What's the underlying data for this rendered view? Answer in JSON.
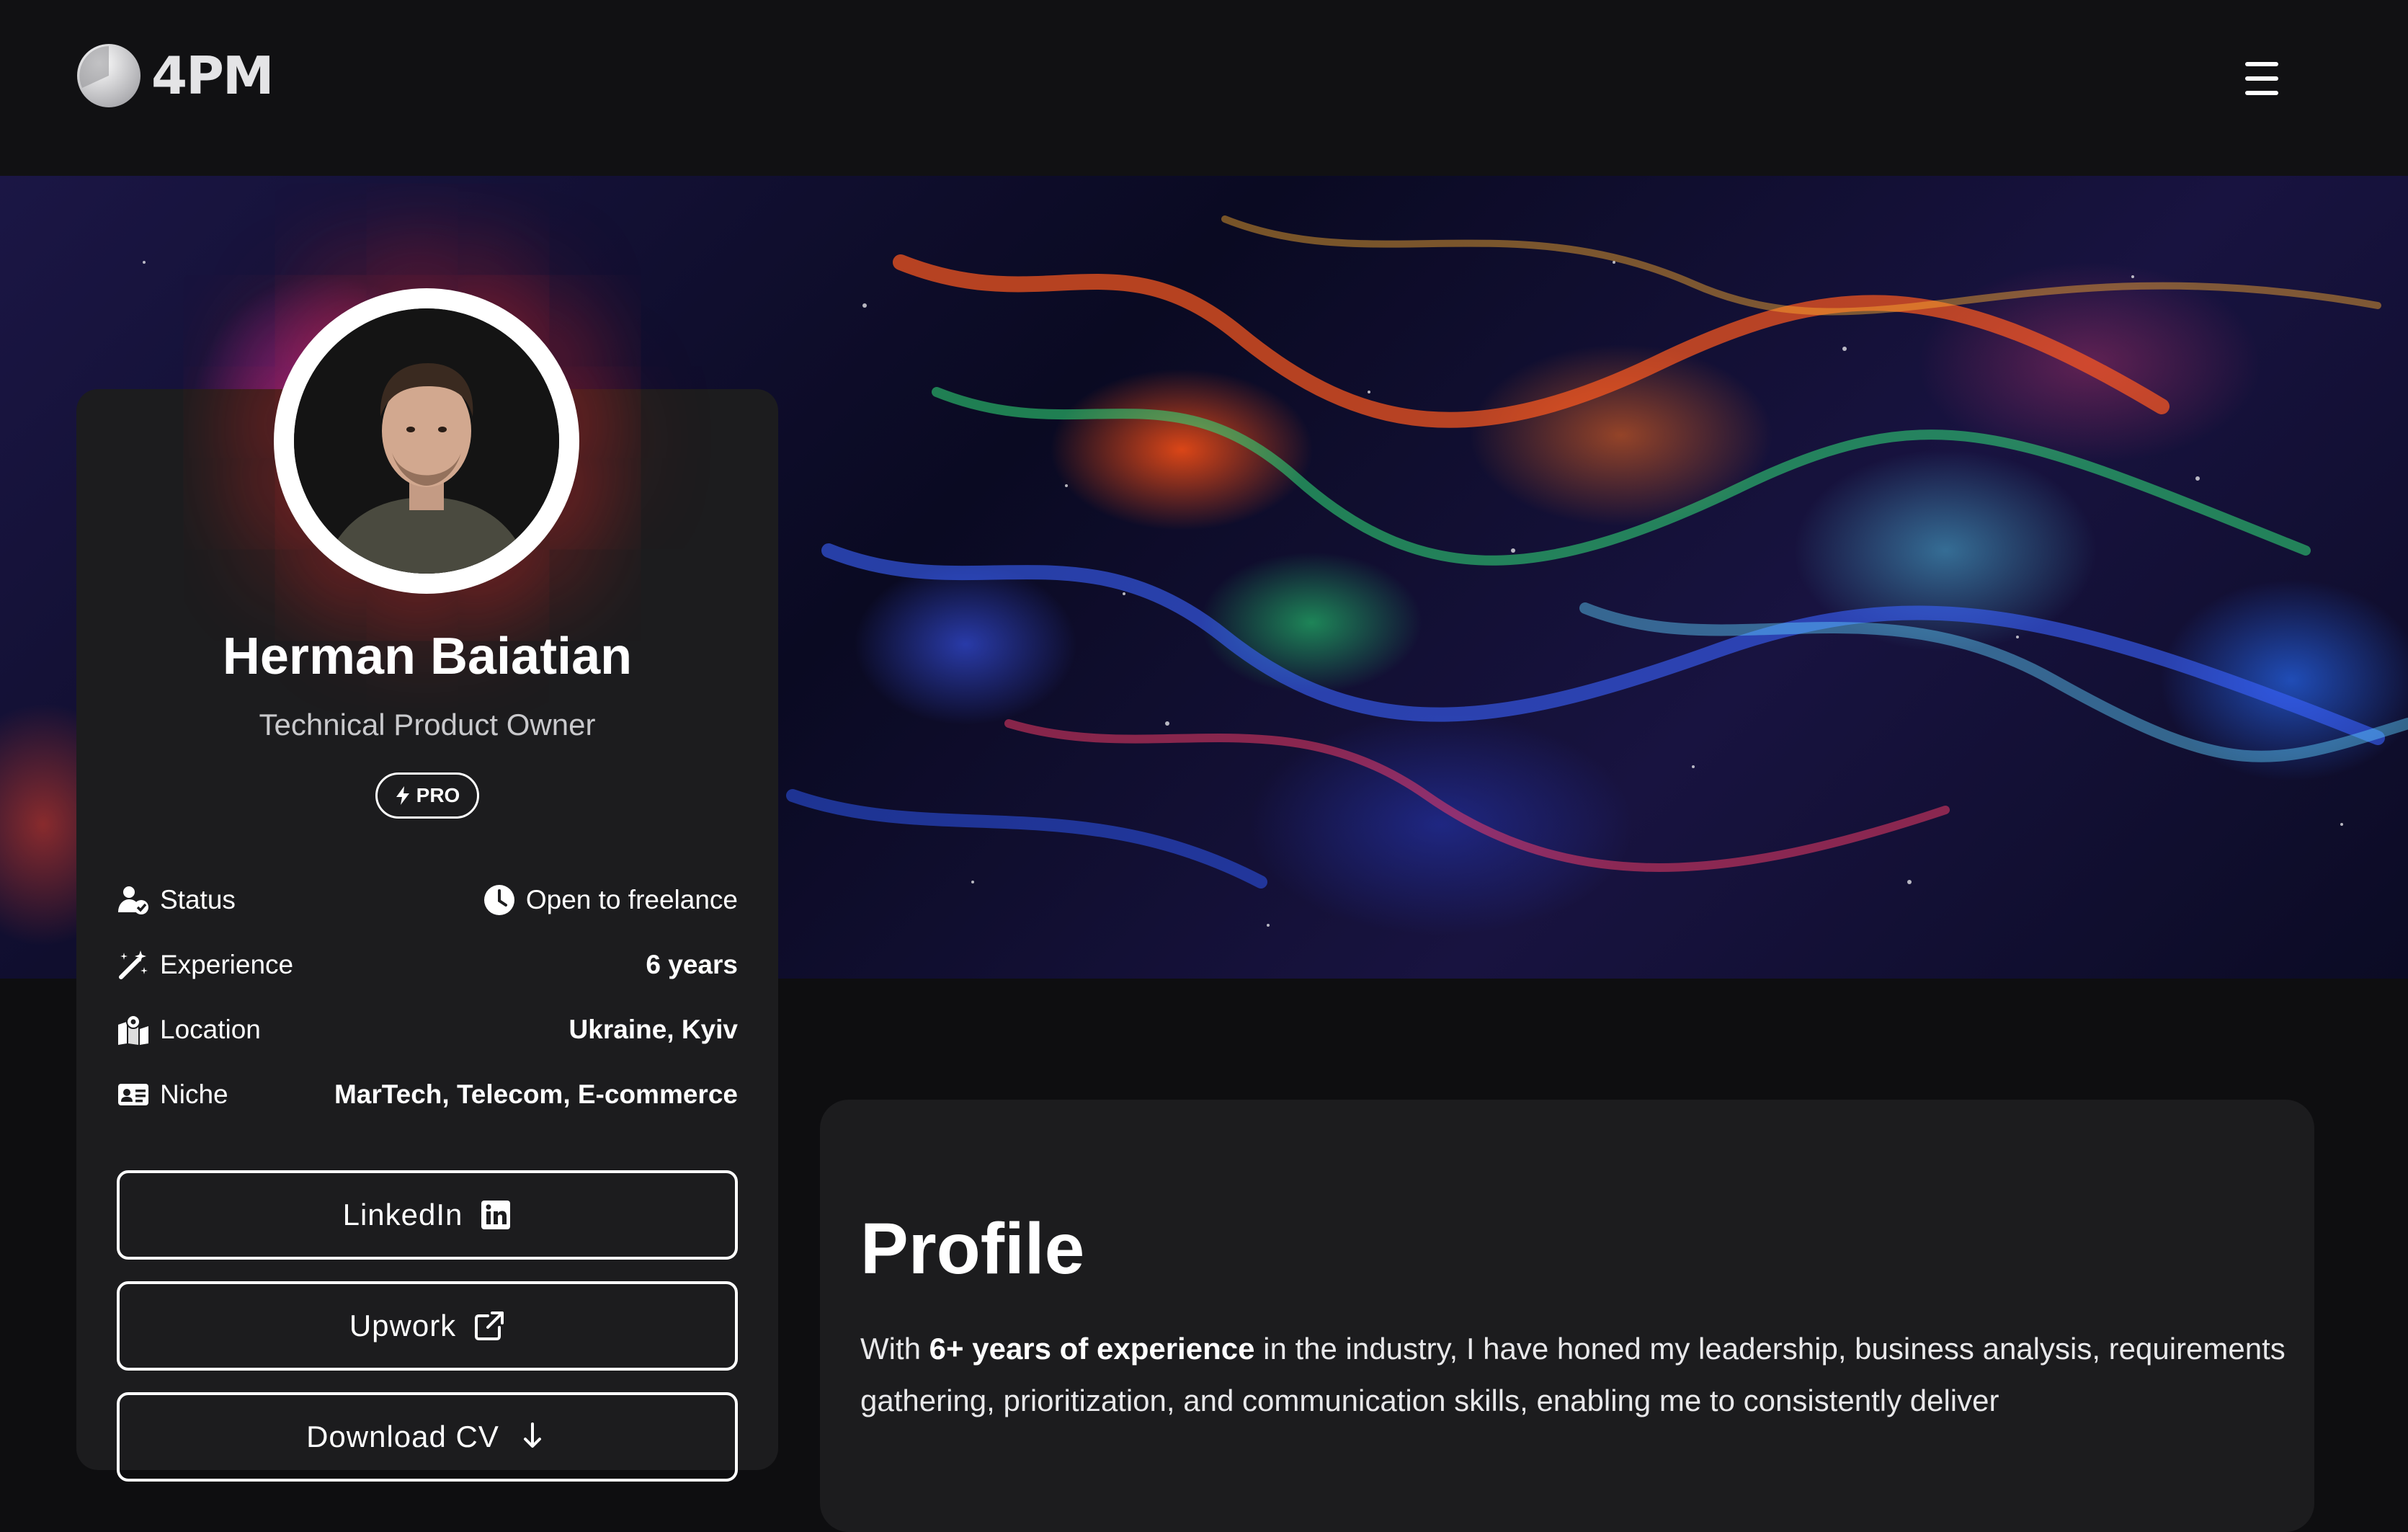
{
  "header": {
    "logo_text": "4PM"
  },
  "profile": {
    "name": "Herman Baiatian",
    "role": "Technical Product Owner",
    "badge": "PRO",
    "info": [
      {
        "label": "Status",
        "value": "Open to freelance",
        "icon": "user-check-icon",
        "value_icon": "clock-icon"
      },
      {
        "label": "Experience",
        "value": "6 years",
        "icon": "magic-wand-icon"
      },
      {
        "label": "Location",
        "value": "Ukraine, Kyiv",
        "icon": "map-pin-icon"
      },
      {
        "label": "Niche",
        "value": "MarTech, Telecom, E-commerce",
        "icon": "id-card-icon"
      }
    ],
    "buttons": {
      "linkedin": "LinkedIn",
      "upwork": "Upwork",
      "download_cv": "Download CV"
    }
  },
  "main": {
    "title": "Profile",
    "text_bold": "6+ years of experience",
    "text_before": "With ",
    "text_after": " in the industry, I have honed my leadership, business analysis, requirements gathering, prioritization, and communication skills, enabling me to consistently deliver"
  },
  "colors": {
    "background": "#0e0e10",
    "card": "#1c1c1e",
    "text": "#ffffff"
  }
}
